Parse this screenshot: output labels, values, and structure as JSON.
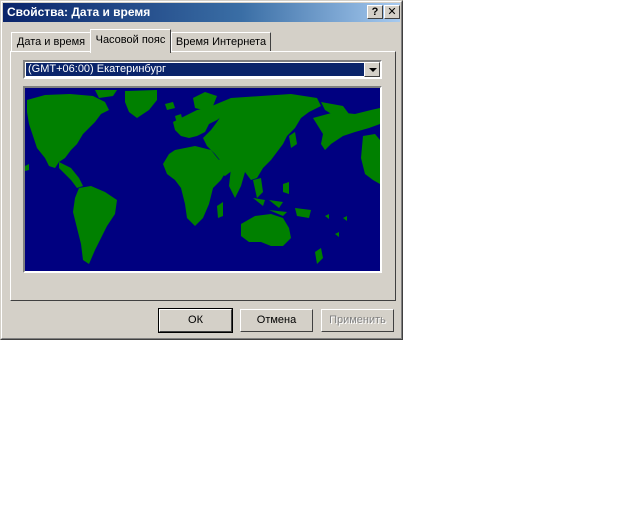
{
  "window": {
    "title": "Свойства: Дата и время",
    "help_glyph": "?",
    "close_glyph": "✕"
  },
  "tabs": [
    {
      "label": "Дата и время",
      "active": false
    },
    {
      "label": "Часовой пояс",
      "active": true
    },
    {
      "label": "Время Интернета",
      "active": false
    }
  ],
  "timezone": {
    "selected": "(GMT+06:00) Екатеринбург"
  },
  "map": {
    "ocean_color": "#000080",
    "land_color": "#008000"
  },
  "buttons": {
    "ok": "ОК",
    "cancel": "Отмена",
    "apply": "Применить"
  }
}
